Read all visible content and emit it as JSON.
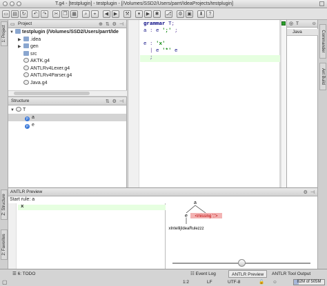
{
  "window": {
    "title": "T.g4 - [testplugin] - testplugin - [/Volumes/SSD2/Users/parrt/IdeaProjects/testplugin]"
  },
  "left_strip": {
    "project_tab": "1: Project",
    "structure_tab": "Z: Structure",
    "favorites_tab": "2: Favorites"
  },
  "right_strip": {
    "commander_tab": "Commander",
    "ant_tab": "Ant Build"
  },
  "project": {
    "title": "Project",
    "header_icons": "⊕ ⇅ ⚙ ⊣",
    "root": "testplugin (/Volumes/SSD2/Users/parrt/Ide",
    "items": [
      {
        "label": ".idea",
        "kind": "folder",
        "expandable": true
      },
      {
        "label": "gen",
        "kind": "folder",
        "expandable": true
      },
      {
        "label": "src",
        "kind": "folder",
        "expandable": false
      },
      {
        "label": "AKTK.g4",
        "kind": "g4"
      },
      {
        "label": "ANTLRv4Lexer.g4",
        "kind": "g4"
      },
      {
        "label": "ANTLRv4Parser.g4",
        "kind": "g4"
      },
      {
        "label": "Java.g4",
        "kind": "g4"
      }
    ]
  },
  "structure": {
    "title": "Structure",
    "header_icons": "⇅ ⚙ ⊣",
    "root": "T",
    "rules": [
      {
        "label": "a",
        "selected": true
      },
      {
        "label": "e",
        "selected": false
      }
    ]
  },
  "editor": {
    "lines": [
      [
        {
          "t": "grammar ",
          "c": "kw"
        },
        {
          "t": "T",
          "c": "id"
        },
        {
          "t": ";",
          "c": "op"
        }
      ],
      [
        {
          "t": "a",
          "c": "id"
        },
        {
          "t": " : ",
          "c": "op"
        },
        {
          "t": "e",
          "c": "id"
        },
        {
          "t": " ';'",
          "c": "str"
        },
        {
          "t": " ;",
          "c": "op"
        }
      ],
      [],
      [
        {
          "t": "e",
          "c": "id"
        },
        {
          "t": " : ",
          "c": "op"
        },
        {
          "t": "'x'",
          "c": "str"
        }
      ],
      [
        {
          "t": "  | ",
          "c": "op"
        },
        {
          "t": "e",
          "c": "id"
        },
        {
          "t": " '*'",
          "c": "str"
        },
        {
          "t": " e",
          "c": "id"
        }
      ],
      [
        {
          "t": "  ;",
          "c": "op"
        }
      ]
    ]
  },
  "sidepanel": {
    "tab_t": "T",
    "tab_java": "Java"
  },
  "antlr_preview": {
    "title": "ANTLR Preview",
    "header_icons": "⚙ ⊣",
    "start_rule_label": "Start rule: a",
    "input_text": "x",
    "parse_tree": {
      "root": "a",
      "child_e": "e",
      "child_missing": "<missing ';'>",
      "leaf": "xIntellijIdeaRulezzz"
    },
    "zoom": 0.5
  },
  "statusbar": {
    "todo_tab": "6: TODO",
    "event_log": "Event Log",
    "antlr_preview_tab": "ANTLR Preview",
    "antlr_tool_output": "ANTLR Tool Output",
    "position": "1:2",
    "line_sep": "LF",
    "encoding": "UTF-8",
    "memory": "82M of 505M",
    "memory_fraction": 0.16
  }
}
